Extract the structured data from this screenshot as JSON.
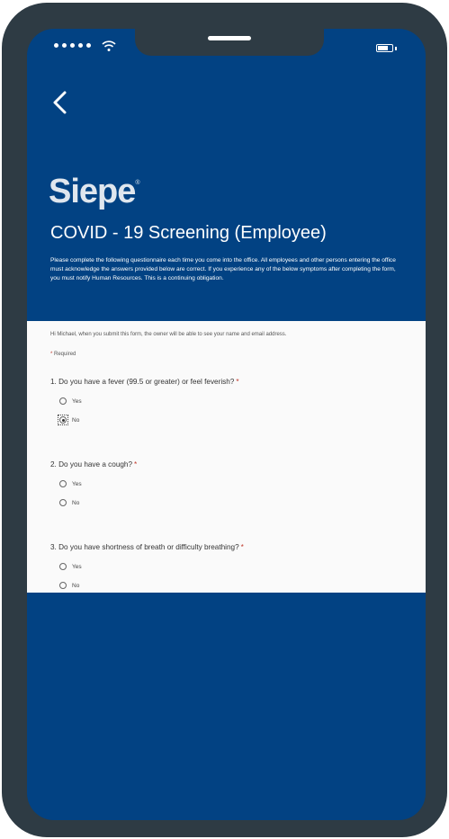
{
  "status_bar": {
    "signal_icon": "signal-dots-icon",
    "wifi_icon": "wifi-icon",
    "battery_icon": "battery-icon"
  },
  "header": {
    "back_icon": "chevron-left-icon",
    "brand": "Siepe",
    "brand_mark": "®",
    "title": "COVID - 19 Screening (Employee)",
    "intro": "Please complete the following questionnaire each time you come into the office.  All employees and other persons entering the office must acknowledge the answers provided below are correct.  If you experience any of the below symptoms after completing the form, you must notify Human Resources.  This is a continuing obligation."
  },
  "form": {
    "notice": "Hi Michael, when you submit this form, the owner will be able to see your name and email address.",
    "required_star": "*",
    "required_label": "Required",
    "questions": [
      {
        "label": "1. Do you have a fever (99.5 or greater) or feel feverish?",
        "star": "*",
        "options": [
          {
            "label": "Yes",
            "selected": false
          },
          {
            "label": "No",
            "selected": true
          }
        ]
      },
      {
        "label": "2. Do you have a cough?",
        "star": "*",
        "options": [
          {
            "label": "Yes",
            "selected": false
          },
          {
            "label": "No",
            "selected": false
          }
        ]
      },
      {
        "label": "3. Do you have shortness of breath or difficulty breathing?",
        "star": "*",
        "options": [
          {
            "label": "Yes",
            "selected": false
          },
          {
            "label": "No",
            "selected": false
          }
        ]
      }
    ]
  },
  "colors": {
    "brand_blue": "#024283",
    "phone_frame": "#2e3b44",
    "required_red": "#c0392b"
  }
}
